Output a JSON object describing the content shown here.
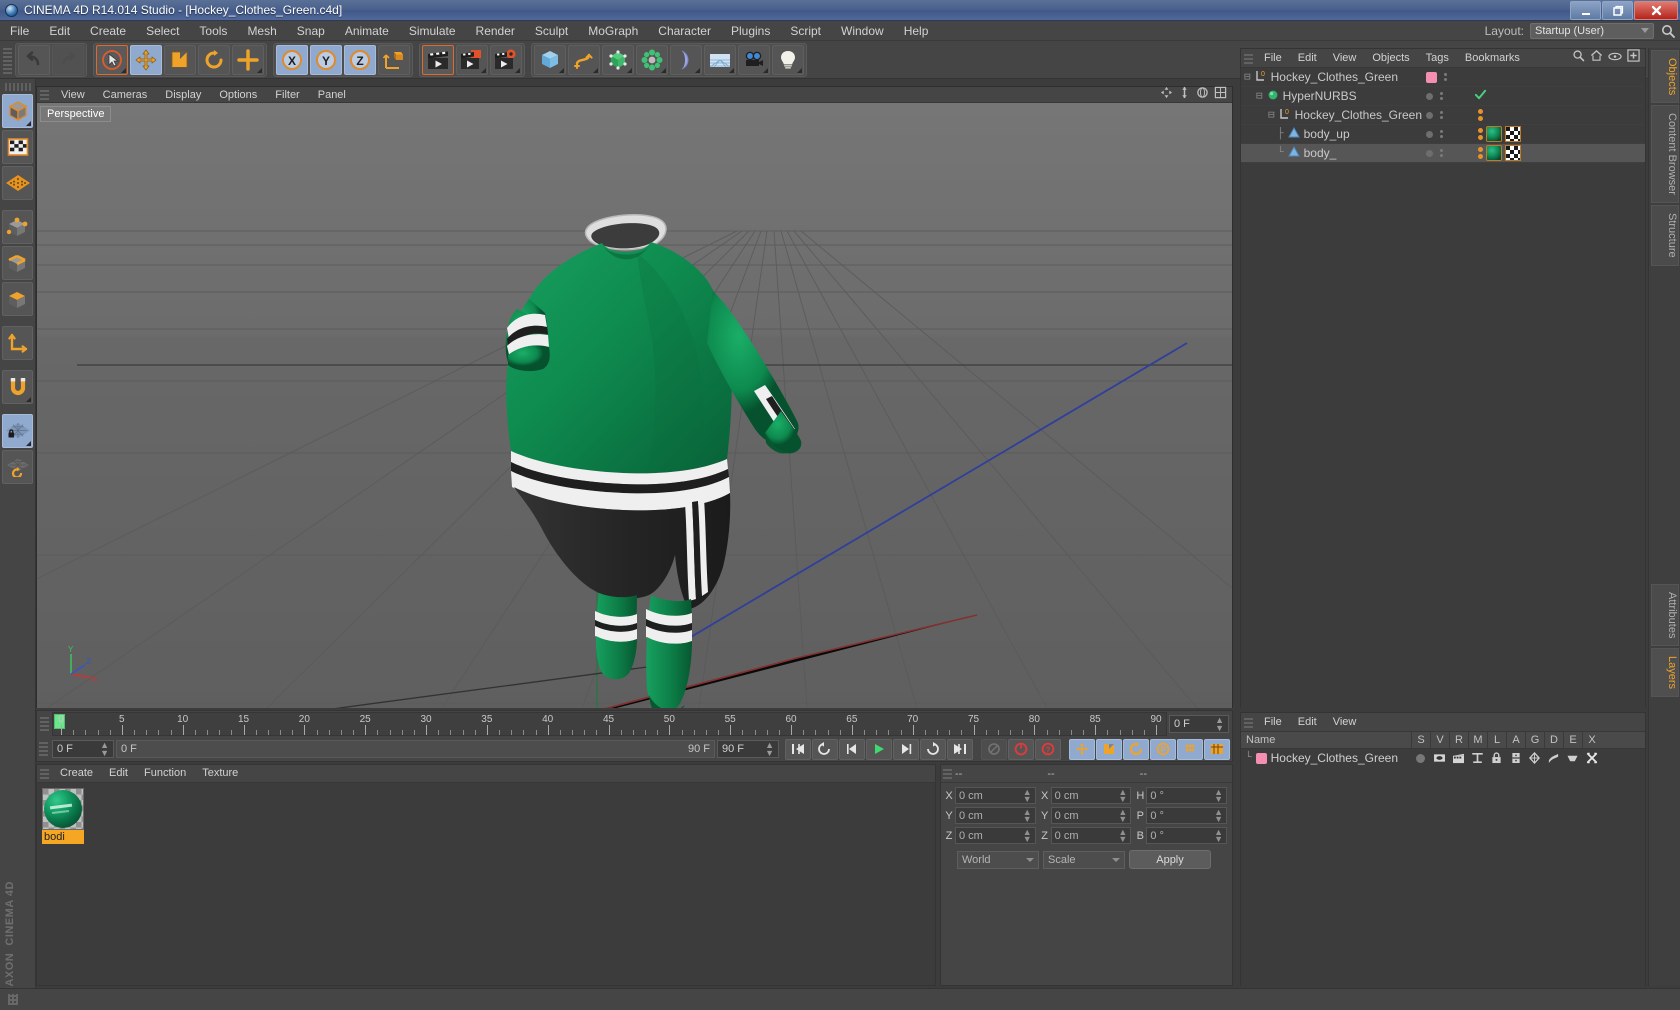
{
  "window": {
    "title": "CINEMA 4D R14.014 Studio - [Hockey_Clothes_Green.c4d]",
    "app_icon": "cinema4d-logo-icon",
    "minimize": "minimize-icon",
    "restore": "restore-icon",
    "close": "close-icon"
  },
  "menubar": {
    "items": [
      "File",
      "Edit",
      "Create",
      "Select",
      "Tools",
      "Mesh",
      "Snap",
      "Animate",
      "Simulate",
      "Render",
      "Sculpt",
      "MoGraph",
      "Character",
      "Plugins",
      "Script",
      "Window",
      "Help"
    ],
    "layout_label": "Layout:",
    "layout_value": "Startup (User)",
    "search_icon": "magnifier-icon"
  },
  "toolbar": {
    "groups": [
      {
        "name": "history",
        "buttons": [
          {
            "icon": "undo-icon",
            "state": "enabled"
          },
          {
            "icon": "redo-icon",
            "state": "disabled"
          }
        ]
      },
      {
        "name": "tools",
        "buttons": [
          {
            "icon": "live-selection-icon",
            "state": "selected"
          },
          {
            "icon": "move-icon",
            "state": "active"
          },
          {
            "icon": "scale-icon",
            "state": "enabled"
          },
          {
            "icon": "rotate-icon",
            "state": "enabled"
          },
          {
            "icon": "move-axis-icon",
            "state": "enabled"
          }
        ]
      },
      {
        "name": "axis-locks",
        "buttons": [
          {
            "icon": "x-axis-icon",
            "state": "active"
          },
          {
            "icon": "y-axis-icon",
            "state": "active"
          },
          {
            "icon": "z-axis-icon",
            "state": "active"
          },
          {
            "icon": "world-coordinate-icon",
            "state": "enabled"
          }
        ]
      },
      {
        "name": "render",
        "buttons": [
          {
            "icon": "render-view-icon",
            "state": "selected"
          },
          {
            "icon": "render-to-picture-viewer-icon",
            "state": "enabled"
          },
          {
            "icon": "render-settings-icon",
            "state": "enabled"
          }
        ]
      },
      {
        "name": "objects",
        "buttons": [
          {
            "icon": "cube-primitive-icon",
            "state": "enabled"
          },
          {
            "icon": "spline-pen-icon",
            "state": "enabled"
          },
          {
            "icon": "hypernurbs-icon",
            "state": "enabled"
          },
          {
            "icon": "array-generator-icon",
            "state": "enabled"
          },
          {
            "icon": "bend-deformer-icon",
            "state": "enabled"
          },
          {
            "icon": "floor-environment-icon",
            "state": "enabled"
          },
          {
            "icon": "camera-icon",
            "state": "enabled"
          },
          {
            "icon": "light-icon",
            "state": "enabled"
          }
        ]
      }
    ]
  },
  "left_toolbar": {
    "buttons": [
      {
        "icon": "model-mode-icon",
        "state": "active"
      },
      {
        "icon": "texture-mode-icon",
        "state": "enabled"
      },
      {
        "icon": "workplane-mode-icon",
        "state": "enabled"
      },
      {
        "icon": "points-mode-icon",
        "state": "enabled"
      },
      {
        "icon": "edges-mode-icon",
        "state": "enabled"
      },
      {
        "icon": "polygons-mode-icon",
        "state": "enabled"
      },
      {
        "icon": "axis-modify-icon",
        "state": "enabled"
      },
      {
        "icon": "enable-snapping-icon",
        "state": "enabled"
      },
      {
        "icon": "lock-workplane-icon",
        "state": "active"
      },
      {
        "icon": "workplane-reset-icon",
        "state": "enabled"
      }
    ],
    "brand_line1": "MAXON",
    "brand_line2": "CINEMA 4D"
  },
  "viewport": {
    "menu": [
      "View",
      "Cameras",
      "Display",
      "Options",
      "Filter",
      "Panel"
    ],
    "label": "Perspective",
    "gizmo_icons": [
      "pan-viewport-icon",
      "zoom-viewport-icon",
      "rotate-viewport-icon",
      "maximize-viewport-icon"
    ],
    "axis_labels": {
      "x": "X",
      "y": "Y",
      "z": "Z"
    },
    "scene_description": "Green hockey jersey, black shorts and green socks on invisible mannequin on a grey grid floor"
  },
  "timeline": {
    "ticks": [
      0,
      5,
      10,
      15,
      20,
      25,
      30,
      35,
      40,
      45,
      50,
      55,
      60,
      65,
      70,
      75,
      80,
      85,
      90
    ],
    "current_frame_top": "0 F",
    "current_frame_left": "0 F",
    "range_start": "0 F",
    "range_end": "90 F",
    "max_frame": "90 F",
    "transport": [
      {
        "icon": "go-to-start-icon"
      },
      {
        "icon": "play-backwards-icon"
      },
      {
        "icon": "previous-frame-icon"
      },
      {
        "icon": "play-forward-icon"
      },
      {
        "icon": "next-frame-icon"
      },
      {
        "icon": "loop-icon"
      },
      {
        "icon": "go-to-end-icon"
      }
    ],
    "record_tools": [
      {
        "icon": "autokeying-icon",
        "state": "disabled"
      },
      {
        "icon": "record-active-objects-icon",
        "state": "enabled"
      },
      {
        "icon": "keyframe-selection-icon",
        "state": "enabled"
      }
    ],
    "key_tools": [
      {
        "icon": "position-key-icon",
        "state": "active"
      },
      {
        "icon": "scale-key-icon",
        "state": "active"
      },
      {
        "icon": "rotation-key-icon",
        "state": "active"
      },
      {
        "icon": "parameter-key-icon",
        "state": "active"
      },
      {
        "icon": "point-level-animation-icon",
        "state": "active"
      },
      {
        "icon": "timeline-icon",
        "state": "active"
      }
    ]
  },
  "material_manager": {
    "menu": [
      "Create",
      "Edit",
      "Function",
      "Texture"
    ],
    "materials": [
      {
        "name": "bodi",
        "thumb": "green-sphere-material-preview",
        "selected": true
      }
    ]
  },
  "coordinates": {
    "headers": [
      "--",
      "--",
      "--"
    ],
    "position": {
      "label_x": "X",
      "label_y": "Y",
      "label_z": "Z",
      "x": "0 cm",
      "y": "0 cm",
      "z": "0 cm"
    },
    "size": {
      "label_x": "X",
      "label_y": "Y",
      "label_z": "Z",
      "x": "0 cm",
      "y": "0 cm",
      "z": "0 cm"
    },
    "rotation": {
      "label_h": "H",
      "label_p": "P",
      "label_b": "B",
      "h": "0 °",
      "p": "0 °",
      "b": "0 °"
    },
    "system": "World",
    "mode": "Scale",
    "apply": "Apply"
  },
  "object_manager": {
    "menu": [
      "File",
      "Edit",
      "View",
      "Objects",
      "Tags",
      "Bookmarks"
    ],
    "header_icons": [
      "search-icon",
      "home-icon",
      "eye-icon",
      "add-layer-icon"
    ],
    "rows": [
      {
        "name": "Hockey_Clothes_Green",
        "icon": "null-object-icon",
        "indent": 0,
        "expanded": true,
        "selected": false,
        "layer_color": "#f48fb1",
        "visible_dot": false,
        "check": false,
        "tags": []
      },
      {
        "name": "HyperNURBS",
        "icon": "hypernurbs-icon",
        "indent": 1,
        "expanded": true,
        "selected": false,
        "layer_color": "",
        "visible_dot": true,
        "check": true,
        "tags": []
      },
      {
        "name": "Hockey_Clothes_Green",
        "icon": "null-object-icon",
        "indent": 2,
        "expanded": true,
        "selected": false,
        "layer_color": "",
        "visible_dot": true,
        "check": false,
        "tags": [
          "dots"
        ]
      },
      {
        "name": "body_up",
        "icon": "polygon-object-icon",
        "indent": 3,
        "expanded": false,
        "selected": false,
        "layer_color": "",
        "visible_dot": true,
        "check": false,
        "tags": [
          "dots",
          "material",
          "uv"
        ]
      },
      {
        "name": "body_",
        "icon": "polygon-object-icon",
        "indent": 3,
        "expanded": false,
        "selected": true,
        "layer_color": "",
        "visible_dot": true,
        "check": false,
        "tags": [
          "dots",
          "material",
          "uv"
        ]
      }
    ]
  },
  "layer_manager": {
    "menu": [
      "File",
      "Edit",
      "View"
    ],
    "columns": [
      "Name",
      "S",
      "V",
      "R",
      "M",
      "L",
      "A",
      "G",
      "D",
      "E",
      "X"
    ],
    "rows": [
      {
        "name": "Hockey_Clothes_Green",
        "color": "#f48fb1",
        "cells": [
          "solo-dot",
          "view-icon",
          "render-icon",
          "manager-icon",
          "lock-icon",
          "animation-icon",
          "generators-icon",
          "deformers-icon",
          "expressions-icon",
          "xpresso-icon"
        ]
      }
    ]
  },
  "rail": {
    "top_tabs": [
      {
        "label": "Objects",
        "active": true
      },
      {
        "label": "Content Browser",
        "active": false
      },
      {
        "label": "Structure",
        "active": false
      }
    ],
    "bottom_tabs": [
      {
        "label": "Attributes",
        "active": false
      },
      {
        "label": "Layers",
        "active": true
      }
    ]
  },
  "statusbar": {
    "text": ""
  },
  "colors": {
    "accent_orange": "#f0a32a",
    "active_blue": "#8fa9cf",
    "panel_bg": "#454545",
    "field_bg": "#3a3a3a",
    "layer_pink": "#f48fb1",
    "jersey_green": "#0f7a4a",
    "playhead_green": "#6ee58c"
  }
}
